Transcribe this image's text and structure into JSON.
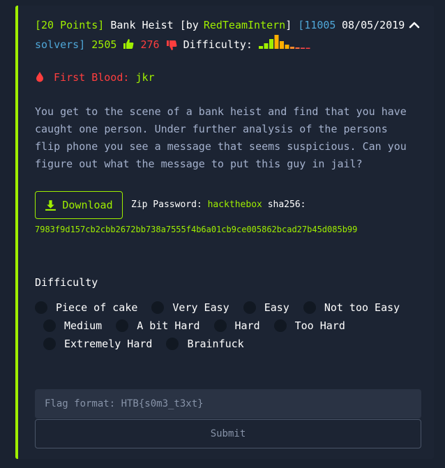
{
  "challenge": {
    "points": "[20 Points]",
    "name": "Bank Heist",
    "by_prefix": "[by",
    "author": "RedTeamIntern",
    "by_suffix": "]",
    "solvers_open": "[11005",
    "solvers_close": "solvers]",
    "date": "08/05/2019",
    "likes": "2505",
    "dislikes": "276",
    "difficulty_label": "Difficulty:",
    "first_blood_label": "First Blood:",
    "first_blood_user": "jkr",
    "description": "You get to the scene of a bank heist and find that you have caught one person. Under further analysis of the persons flip phone you see a message that seems suspicious. Can you figure out what the message to put this guy in jail?",
    "download_label": "Download",
    "zip_password_label": "Zip Password:",
    "zip_password": "hackthebox",
    "sha_label": "sha256:",
    "sha256": "7983f9d157cb2cbb2672bb738a7555f4b6a01cb9ce005862bcad27b45d085b99"
  },
  "difficulty_chart": {
    "values": [
      0.2,
      0.4,
      0.7,
      1.0,
      0.55,
      0.3,
      0.15,
      0.1,
      0.08,
      0.05
    ],
    "colors": [
      "#9fef00",
      "#9fef00",
      "#9fef00",
      "#ffaf00",
      "#ffaf00",
      "#ffaf00",
      "#ff8a2a",
      "#ff6a3d",
      "#ff4b4b",
      "#ff3e3e"
    ]
  },
  "difficulty_options": [
    "Piece of cake",
    "Very Easy",
    "Easy",
    "Not too Easy",
    "Medium",
    "A bit Hard",
    "Hard",
    "Too Hard",
    "Extremely Hard",
    "Brainfuck"
  ],
  "difficulty_section_title": "Difficulty",
  "flag": {
    "placeholder": "Flag format: HTB{s0m3_t3xt}"
  },
  "submit_label": "Submit",
  "icons": [
    "chevron-up-icon",
    "thumbs-up-icon",
    "thumbs-down-icon",
    "blood-drop-icon",
    "download-icon"
  ]
}
